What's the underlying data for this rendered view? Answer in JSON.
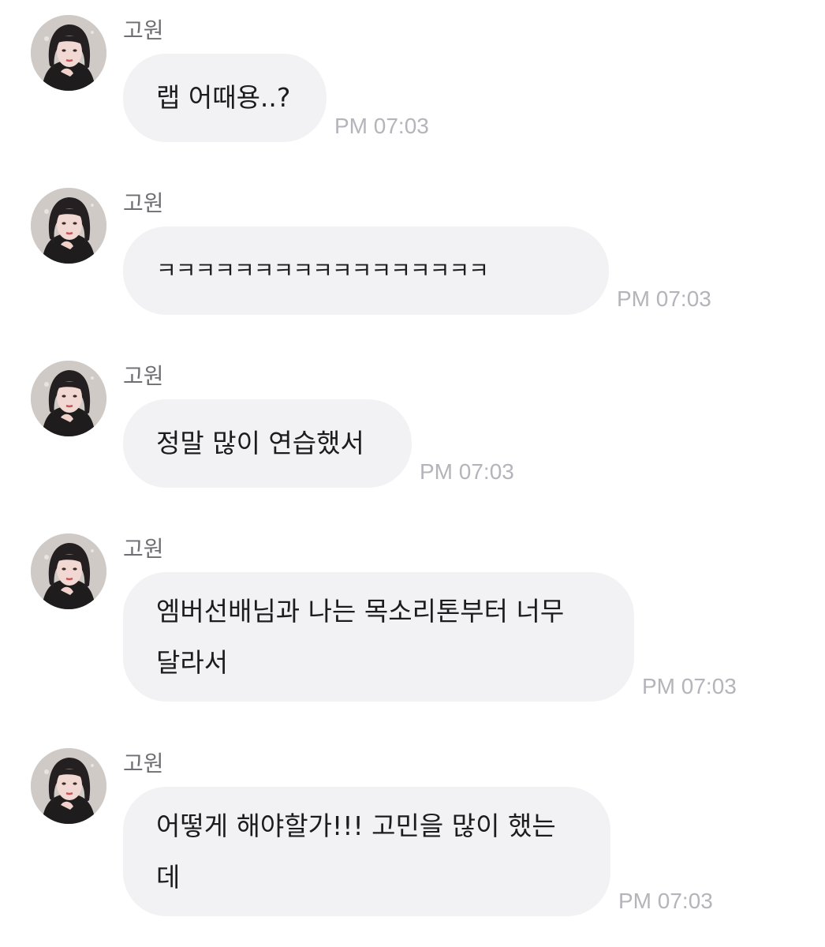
{
  "chat": {
    "messages": [
      {
        "sender": "고원",
        "text": "랩 어때용..?",
        "time": "PM 07:03"
      },
      {
        "sender": "고원",
        "text": "ㅋㅋㅋㅋㅋㅋㅋㅋㅋㅋㅋㅋㅋㅋㅋㅋㅋ",
        "time": "PM 07:03"
      },
      {
        "sender": "고원",
        "text": "정말 많이 연습했서",
        "time": "PM 07:03"
      },
      {
        "sender": "고원",
        "text": "엠버선배님과 나는 목소리톤부터 너무\n달라서",
        "time": "PM 07:03"
      },
      {
        "sender": "고원",
        "text": "어떻게 해야할가!!! 고민을 많이 했는\n데",
        "time": "PM 07:03"
      }
    ]
  },
  "colors": {
    "bubble_background": "#f2f2f5",
    "sender_text": "#6e6e73",
    "message_text": "#1c1c1e",
    "timestamp_text": "#b4b4ba",
    "page_background": "#ffffff"
  },
  "icons": {
    "avatar": "profile-photo-avatar"
  }
}
